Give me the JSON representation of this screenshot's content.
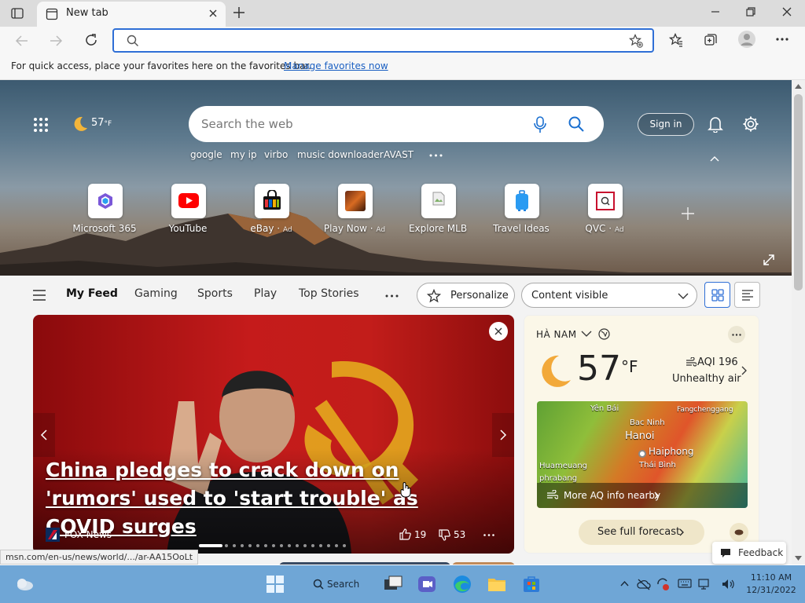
{
  "browser": {
    "tab_title": "New tab",
    "favorites_bar": {
      "prompt": "For quick access, place your favorites here on the favorites bar.",
      "manage_link": "Manage favorites now"
    },
    "status_url": "msn.com/en-us/news/world/.../ar-AA15OoLt"
  },
  "ntp": {
    "weather_mini": "57",
    "weather_mini_unit": "°F",
    "search_placeholder": "Search the web",
    "suggestions": [
      "google",
      "my ip",
      "virbo",
      "music downloader",
      "AVAST"
    ],
    "sign_in": "Sign in",
    "quick_links": [
      {
        "label": "Microsoft 365",
        "ad": ""
      },
      {
        "label": "YouTube",
        "ad": ""
      },
      {
        "label": "eBay",
        "ad": "Ad"
      },
      {
        "label": "Play Now",
        "ad": "Ad"
      },
      {
        "label": "Explore MLB",
        "ad": ""
      },
      {
        "label": "Travel Ideas",
        "ad": ""
      },
      {
        "label": "QVC",
        "ad": "Ad"
      }
    ],
    "feed_tabs": [
      "My Feed",
      "Gaming",
      "Sports",
      "Play",
      "Top Stories"
    ],
    "personalize": "Personalize",
    "content_visibility": "Content visible",
    "news": {
      "headline": "China pledges to crack down on 'rumors' used to 'start trouble' as COVID surges",
      "source": "FOX News",
      "likes": "19",
      "dislikes": "53"
    },
    "weather": {
      "location": "HÀ NAM",
      "temp": "57",
      "unit": "°F",
      "aqi": "AQI 196",
      "aqi_status": "Unhealthy air",
      "map_labels": [
        "Yên Bái",
        "Fangchenggang",
        "Bac Ninh",
        "Hanoi",
        "Haiphong",
        "Thái Bình",
        "Huameuang",
        "phrabang"
      ],
      "aq_link": "More AQ info nearby",
      "forecast_button": "See full forecast"
    },
    "feedback": "Feedback"
  },
  "taskbar": {
    "search_label": "Search",
    "time": "11:10 AM",
    "date": "12/31/2022"
  },
  "colors": {
    "accent": "#2f6fd6",
    "taskbar": "#6fa6d6",
    "news_bg": "#c51b1b"
  }
}
